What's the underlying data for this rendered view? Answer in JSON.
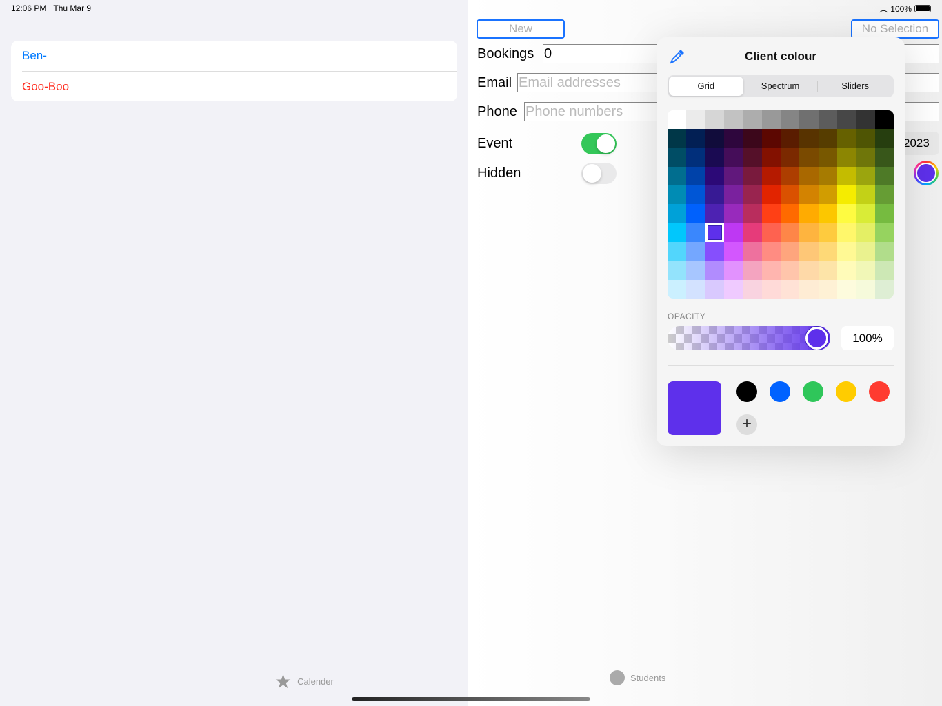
{
  "status": {
    "time": "12:06 PM",
    "date": "Thu Mar 9",
    "battery": "100%"
  },
  "sidebar": {
    "items": [
      {
        "label": "Ben-",
        "color": "#007aff"
      },
      {
        "label": "Goo-Boo",
        "color": "#ff2d20"
      }
    ]
  },
  "detail": {
    "new_button": "New",
    "no_selection_button": "No Selection",
    "bookings_label": "Bookings",
    "bookings_value": "0",
    "email_label": "Email",
    "email_placeholder": "Email addresses",
    "phone_label": "Phone",
    "phone_placeholder": "Phone numbers",
    "event_label": "Event",
    "event_on": true,
    "hidden_label": "Hidden",
    "hidden_on": false,
    "date_partial": "2023"
  },
  "picker": {
    "title": "Client colour",
    "segments": [
      "Grid",
      "Spectrum",
      "Sliders"
    ],
    "selected_segment": "Grid",
    "grid": [
      [
        "#ffffff",
        "#ebebeb",
        "#d6d6d6",
        "#c2c2c2",
        "#adadad",
        "#999999",
        "#858585",
        "#707070",
        "#5c5c5c",
        "#474747",
        "#333333",
        "#000000"
      ],
      [
        "#003748",
        "#021f54",
        "#110c3b",
        "#2e063d",
        "#3c071b",
        "#5c0701",
        "#5a1c00",
        "#583300",
        "#563d00",
        "#666100",
        "#4f5504",
        "#263e0f"
      ],
      [
        "#004d65",
        "#012f7b",
        "#1a0a52",
        "#450d59",
        "#551029",
        "#831100",
        "#7b2900",
        "#7a4a00",
        "#785800",
        "#8c8602",
        "#6f760a",
        "#38571a"
      ],
      [
        "#016e8f",
        "#0042a9",
        "#2c0977",
        "#61187c",
        "#791a3d",
        "#b51a00",
        "#ad3e00",
        "#a96800",
        "#a67b01",
        "#c4bc00",
        "#9ba50e",
        "#4e7a27"
      ],
      [
        "#008cb4",
        "#0056d6",
        "#371a94",
        "#7a219e",
        "#99244f",
        "#e22400",
        "#da5100",
        "#d38301",
        "#d19d01",
        "#f5ec00",
        "#c3d117",
        "#669d34"
      ],
      [
        "#00a1d8",
        "#0061fd",
        "#4d22b2",
        "#982abc",
        "#b92d5d",
        "#ff4015",
        "#ff6a00",
        "#ffab01",
        "#fcc700",
        "#fefb41",
        "#d9ec37",
        "#76bb40"
      ],
      [
        "#01c7fc",
        "#3a87fd",
        "#5e30eb",
        "#be38f3",
        "#e63b7a",
        "#fe6250",
        "#fe8648",
        "#feb43f",
        "#fecb3e",
        "#fff76b",
        "#e4ef65",
        "#96d35f"
      ],
      [
        "#52d6fc",
        "#74a7ff",
        "#864ffd",
        "#d357fe",
        "#ee719e",
        "#ff8c82",
        "#fea57d",
        "#fec777",
        "#fed977",
        "#fff994",
        "#eaf28f",
        "#b1dd8b"
      ],
      [
        "#93e3fc",
        "#a7c6ff",
        "#b18cfe",
        "#e292fe",
        "#f4a4c0",
        "#ffb5af",
        "#ffc5ab",
        "#fed9a8",
        "#fde4a8",
        "#fffbb9",
        "#f1f7b7",
        "#cde8b5"
      ],
      [
        "#cbf0ff",
        "#d3e2ff",
        "#d9c9fe",
        "#efcaff",
        "#f9d3e0",
        "#ffdad8",
        "#ffe2d6",
        "#feecd4",
        "#fef1d5",
        "#fdfbdd",
        "#f6fadb",
        "#deeed4"
      ]
    ],
    "selected_color": "#5e30eb",
    "opacity_label": "OPACITY",
    "opacity_value": "100%",
    "opacity": 1.0,
    "swatches": [
      "#000000",
      "#0062ff",
      "#2fc65a",
      "#ffcc00",
      "#ff3b30"
    ],
    "add_swatch": "+"
  },
  "tabbar": {
    "tabs": [
      {
        "label": "Calender",
        "icon": "star-icon"
      },
      {
        "label": "Students",
        "icon": "circle-icon"
      }
    ]
  }
}
